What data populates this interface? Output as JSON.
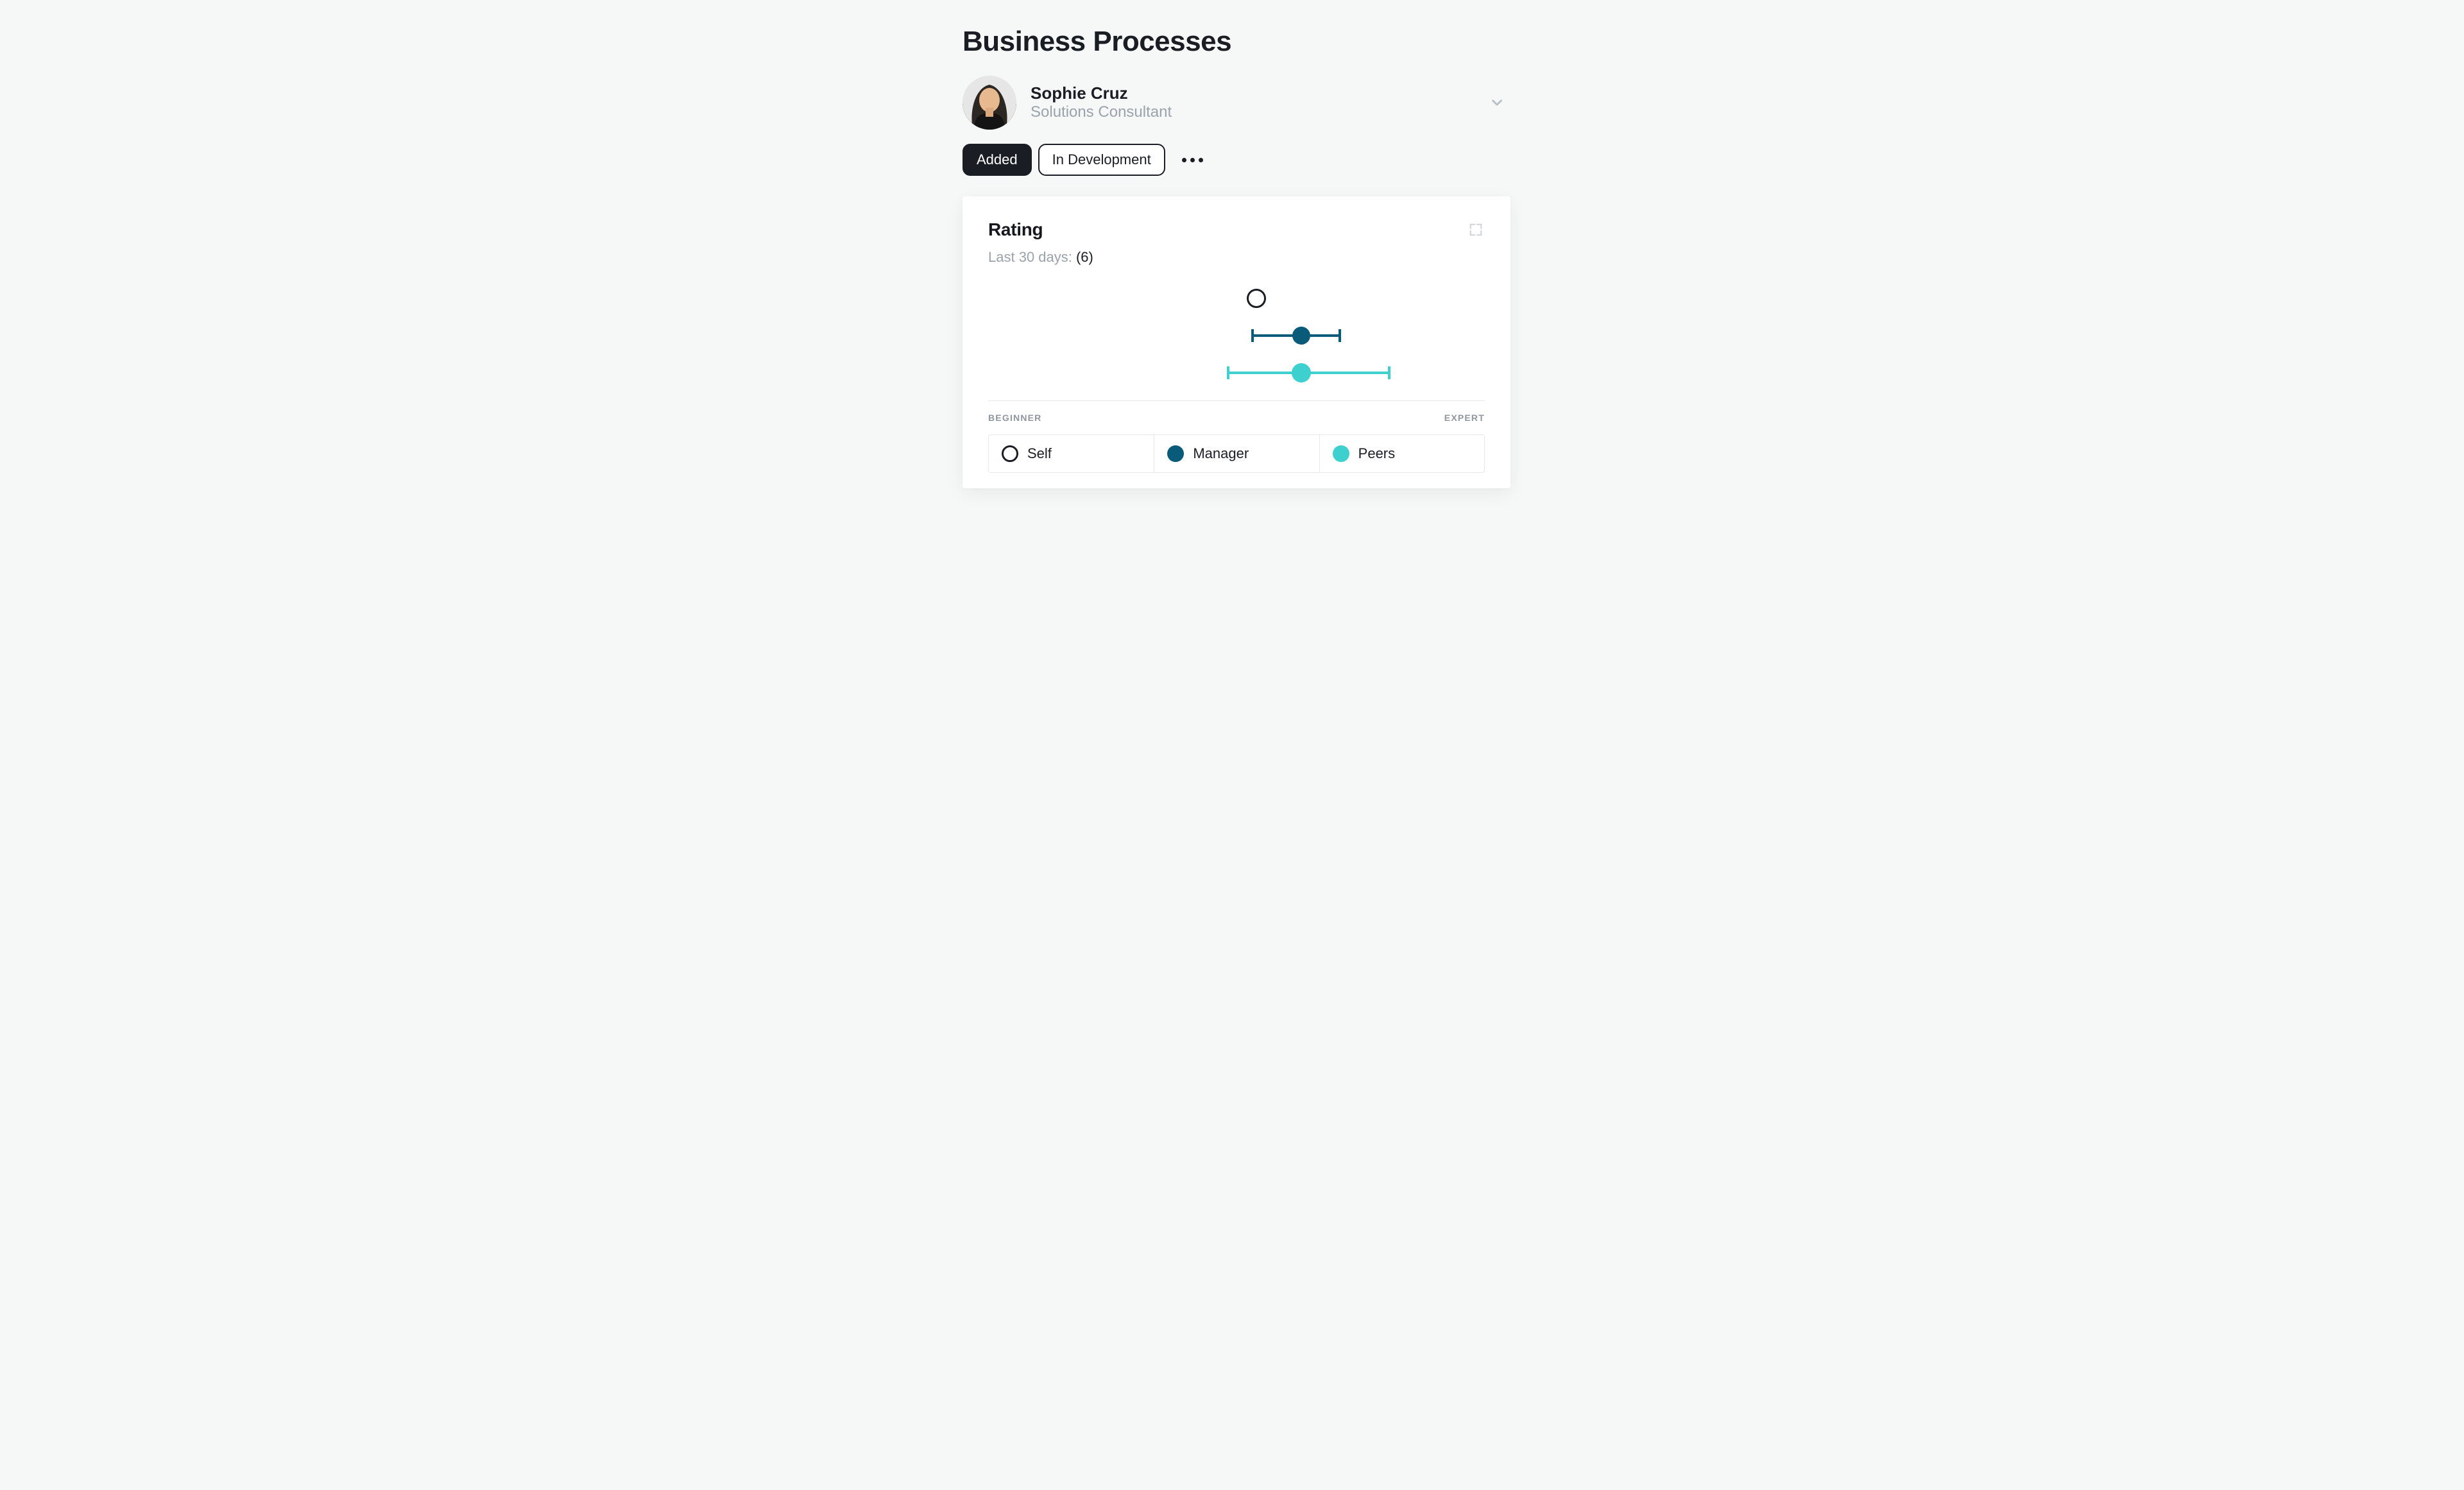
{
  "page_title": "Business Processes",
  "profile": {
    "name": "Sophie Cruz",
    "role": "Solutions Consultant"
  },
  "tabs": {
    "added": "Added",
    "in_development": "In Development",
    "active": "added"
  },
  "card": {
    "title": "Rating",
    "sub_label": "Last 30 days: ",
    "count_text": "(6)"
  },
  "axis": {
    "min_label": "BEGINNER",
    "max_label": "EXPERT"
  },
  "legend": {
    "self": "Self",
    "manager": "Manager",
    "peers": "Peers"
  },
  "colors": {
    "self_stroke": "#15181d",
    "manager": "#0a5b7a",
    "peers": "#3dd0cf"
  },
  "chart_data": {
    "type": "scatter",
    "title": "Rating",
    "xlabel": "",
    "ylabel": "",
    "xlim": [
      0,
      100
    ],
    "x_axis_meaning": "skill level from Beginner (0) to Expert (100)",
    "tick_labels": [
      "BEGINNER",
      "EXPERT"
    ],
    "series": [
      {
        "name": "Self",
        "value": 54,
        "low": null,
        "high": null
      },
      {
        "name": "Manager",
        "value": 63,
        "low": 53,
        "high": 71
      },
      {
        "name": "Peers",
        "value": 63,
        "low": 48,
        "high": 81
      }
    ],
    "legend_position": "bottom",
    "annotations": [
      "Last 30 days: (6)"
    ]
  }
}
